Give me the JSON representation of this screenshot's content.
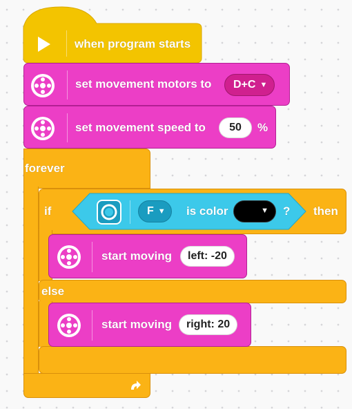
{
  "blocks": {
    "start": {
      "label": "when program starts",
      "icon": "play-icon"
    },
    "set_motors": {
      "label": "set movement motors to",
      "value": "D+C"
    },
    "set_speed": {
      "label": "set movement speed to",
      "value": "50",
      "unit": "%"
    },
    "forever": {
      "label": "forever",
      "loop_icon": "loop-arrow-icon"
    },
    "if_else": {
      "if_label": "if",
      "then_label": "then",
      "else_label": "else",
      "condition": {
        "sensor_icon": "color-sensor-icon",
        "port": "F",
        "text": "is color",
        "color_value": "black",
        "question": "?"
      }
    },
    "start_moving_1": {
      "label": "start moving",
      "value": "left: -20"
    },
    "start_moving_2": {
      "label": "start moving",
      "value": "right: 20"
    }
  },
  "colors": {
    "events": "#f3c400",
    "motors": "#ec3ec6",
    "control": "#fbb315",
    "sensors": "#3cc9ea"
  }
}
